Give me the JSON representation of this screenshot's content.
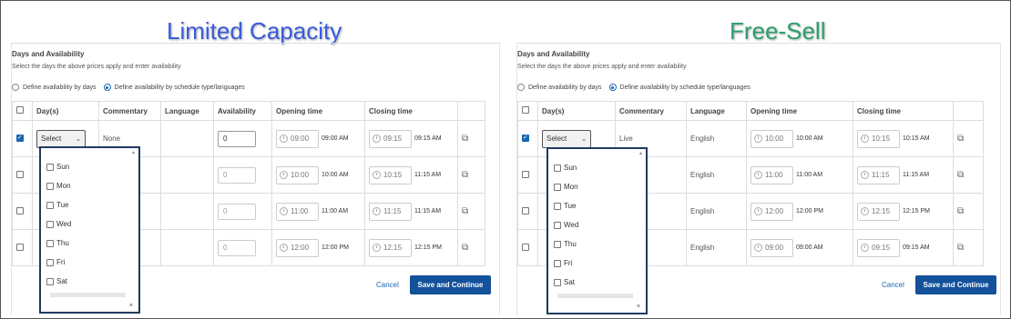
{
  "left": {
    "banner": "Limited Capacity",
    "banner_color": "#3b5bdb",
    "section_title": "Days and Availability",
    "section_subtitle": "Select the days the above prices apply and enter availability",
    "radio_days": "Define availability by days",
    "radio_schedule": "Define availability by schedule type/languages",
    "headers": [
      "Day(s)",
      "Commentary",
      "Language",
      "Availability",
      "Opening time",
      "Closing time"
    ],
    "rows": [
      {
        "commentary": "None",
        "language": "",
        "availability": "0",
        "open": "09:00",
        "open_label": "09:00 AM",
        "close": "09:15",
        "close_label": "09:15 AM",
        "checked": true
      },
      {
        "commentary": "",
        "language": "",
        "availability": "0",
        "open": "10:00",
        "open_label": "10:00 AM",
        "close": "10:15",
        "close_label": "11:15 AM",
        "checked": false
      },
      {
        "commentary": "",
        "language": "",
        "availability": "0",
        "open": "11:00",
        "open_label": "11:00 AM",
        "close": "11:15",
        "close_label": "11:15 AM",
        "checked": false
      },
      {
        "commentary": "",
        "language": "",
        "availability": "0",
        "open": "12:00",
        "open_label": "12:00 PM",
        "close": "12:15",
        "close_label": "12:15 PM",
        "checked": false
      }
    ],
    "select_label": "Select",
    "days": [
      "Sun",
      "Mon",
      "Tue",
      "Wed",
      "Thu",
      "Fri",
      "Sat"
    ],
    "cancel": "Cancel",
    "save": "Save and Continue"
  },
  "right": {
    "banner": "Free-Sell",
    "banner_color": "#2e9e6e",
    "section_title": "Days and Availability",
    "section_subtitle": "Select the days the above prices apply and enter availability",
    "radio_days": "Define availability by days",
    "radio_schedule": "Define availability by schedule type/languages",
    "headers": [
      "Day(s)",
      "Commentary",
      "Language",
      "Opening time",
      "Closing time"
    ],
    "rows": [
      {
        "commentary": "Live",
        "language": "English",
        "open": "10:00",
        "open_label": "10:00 AM",
        "close": "10:15",
        "close_label": "10:15 AM",
        "checked": true
      },
      {
        "commentary": "",
        "language": "English",
        "open": "11:00",
        "open_label": "11:00 AM",
        "close": "11:15",
        "close_label": "11:15 AM",
        "checked": false
      },
      {
        "commentary": "",
        "language": "English",
        "open": "12:00",
        "open_label": "12:00 PM",
        "close": "12:15",
        "close_label": "12:15 PM",
        "checked": false
      },
      {
        "commentary": "",
        "language": "English",
        "open": "09:00",
        "open_label": "09:00 AM",
        "close": "09:15",
        "close_label": "09:15 AM",
        "checked": false
      }
    ],
    "select_label": "Select",
    "days": [
      "Sun",
      "Mon",
      "Tue",
      "Wed",
      "Thu",
      "Fri",
      "Sat"
    ],
    "cancel": "Cancel",
    "save": "Save and Continue"
  },
  "accent_color": "#13519a"
}
